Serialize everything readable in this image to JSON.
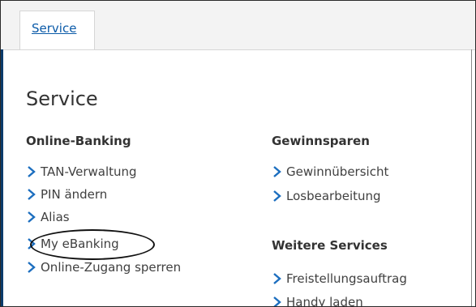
{
  "tab": {
    "label": "Service"
  },
  "page_title": "Service",
  "columns": [
    {
      "heading": "Online-Banking",
      "links": [
        "TAN-Verwaltung",
        "PIN ändern",
        "Alias",
        "My eBanking",
        "Online-Zugang sperren"
      ]
    },
    {
      "heading": "Gewinnsparen",
      "links": [
        "Gewinnübersicht",
        "Losbearbeitung"
      ]
    },
    {
      "heading": "Weitere Services",
      "links": [
        "Freistellungsauftrag",
        "Handy laden"
      ]
    }
  ],
  "icons": {
    "link_bullet": "chevron-right-icon"
  },
  "colors": {
    "accent": "#1c6ebf",
    "tab_link": "#0a5aa8",
    "text": "#404040",
    "heading": "#333333"
  }
}
